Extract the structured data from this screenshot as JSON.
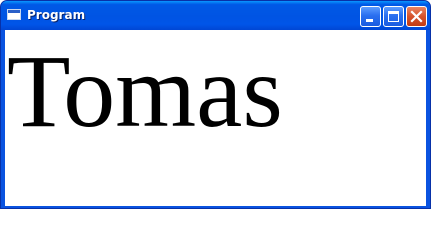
{
  "window": {
    "title": "Program",
    "icon": "window-icon",
    "controls": {
      "minimize_icon": "minimize-icon",
      "maximize_icon": "maximize-icon",
      "close_icon": "close-icon"
    },
    "colors": {
      "titlebar": "#0054e3",
      "close_button": "#d5532c",
      "client_background": "#ffffff"
    }
  },
  "content": {
    "text": "Tomas"
  }
}
